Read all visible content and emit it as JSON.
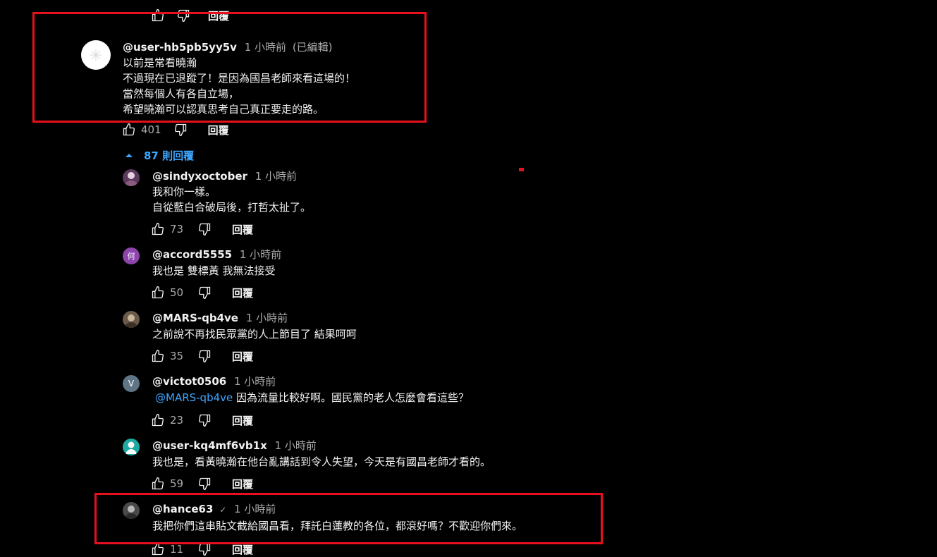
{
  "labels": {
    "reply": "回覆",
    "edited": "(已編輯)"
  },
  "colors": {
    "background": "#000000",
    "link": "#3ea6ff",
    "highlight": "#e8101e",
    "muted": "#aaaaaa"
  },
  "top_partial": {
    "reply": "回覆"
  },
  "main_comment": {
    "author": "@user-hb5pb5yy5v",
    "time": "1 小時前",
    "edited": "(已編輯)",
    "lines": [
      "以前是常看曉瀚",
      "不過現在已退蹤了！是因為國昌老師來看這場的！",
      "當然每個人有各自立場，",
      "希望曉瀚可以認真思考自己真正要走的路。"
    ],
    "likes": "401",
    "reply": "回覆"
  },
  "replies_toggle": {
    "label": "87 則回覆",
    "icon": "caret-up-icon"
  },
  "replies": [
    {
      "author": "@sindyxoctober",
      "time": "1 小時前",
      "lines": [
        "我和你一樣。",
        "自從藍白合破局後，打哲太扯了。"
      ],
      "likes": "73",
      "avatar": {
        "type": "photo",
        "color": "#5b3a5e"
      }
    },
    {
      "author": "@accord5555",
      "time": "1 小時前",
      "lines": [
        "我也是 雙標黃 我無法接受"
      ],
      "likes": "50",
      "avatar": {
        "type": "letter",
        "letter": "何",
        "color": "#8e44ad"
      }
    },
    {
      "author": "@MARS-qb4ve",
      "time": "1 小時前",
      "lines": [
        "之前說不再找民眾黨的人上節目了 結果呵呵"
      ],
      "likes": "35",
      "avatar": {
        "type": "photo",
        "color": "#6b5a4a"
      }
    },
    {
      "author": "@victot0506",
      "time": "1 小時前",
      "mention": "@MARS-qb4ve",
      "lines": [
        " 因為流量比較好啊。國民黨的老人怎麼會看這些？"
      ],
      "likes": "23",
      "avatar": {
        "type": "letter",
        "letter": "V",
        "color": "#5f7585"
      }
    },
    {
      "author": "@user-kq4mf6vb1x",
      "time": "1 小時前",
      "lines": [
        "我也是，看黃曉瀚在他台亂講話到令人失望，今天是有國昌老師才看的。"
      ],
      "likes": "59",
      "avatar": {
        "type": "person",
        "color": "#1fa9a1"
      }
    },
    {
      "author": "@hance63",
      "verified_icon": "check-icon",
      "time": "1 小時前",
      "lines": [
        "我把你們這串貼文截給國昌看，拜託白蓮教的各位，都滾好嗎？不歡迎你們來。"
      ],
      "likes": "11",
      "avatar": {
        "type": "photo",
        "color": "#4a4a4a"
      }
    }
  ]
}
